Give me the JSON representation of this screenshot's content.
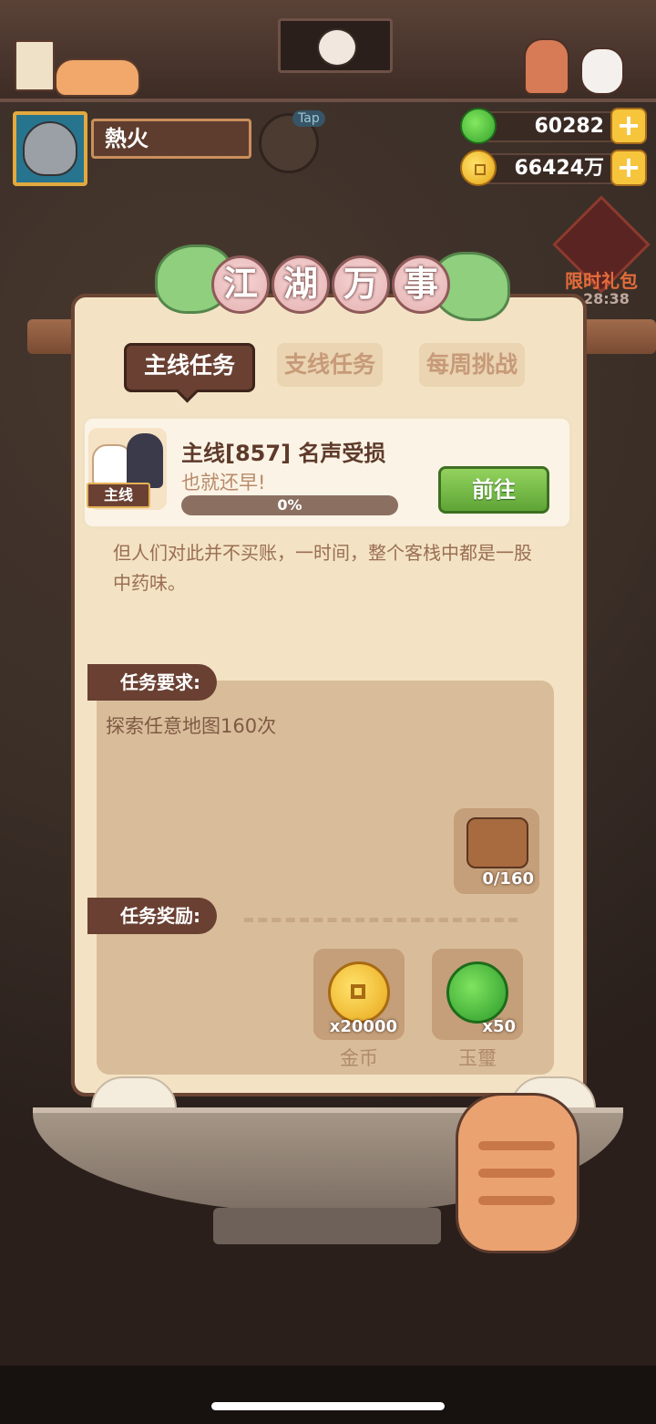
{
  "player": {
    "name": "熱火"
  },
  "tap_label": "Tap",
  "currency": {
    "jade": "60282",
    "gold": "66424万"
  },
  "limited": {
    "label": "限时礼包",
    "timer": "28:38"
  },
  "title_chars": [
    "江",
    "湖",
    "万",
    "事"
  ],
  "tabs": [
    {
      "label": "主线任务",
      "active": true
    },
    {
      "label": "支线任务",
      "active": false
    },
    {
      "label": "每周挑战",
      "active": false
    }
  ],
  "task": {
    "tag": "主线",
    "title": "主线[857] 名声受损",
    "subtitle": "也就还早!",
    "progress": 0,
    "progress_text": "0%",
    "go_label": "前往",
    "description": "但人们对此并不买账，一时间，整个客栈中都是一股中药味。"
  },
  "requirement": {
    "label": "任务要求:",
    "text": "探索任意地图160次",
    "count": "0/160"
  },
  "reward": {
    "label": "任务奖励:",
    "items": [
      {
        "name": "金币",
        "qty": "x20000",
        "icon": "coin-icon"
      },
      {
        "name": "玉璽",
        "qty": "x50",
        "icon": "jade-icon"
      }
    ]
  },
  "colors": {
    "panel": "#f3e3c4",
    "accent_brown": "#6a4032",
    "go_green": "#5ea536"
  }
}
